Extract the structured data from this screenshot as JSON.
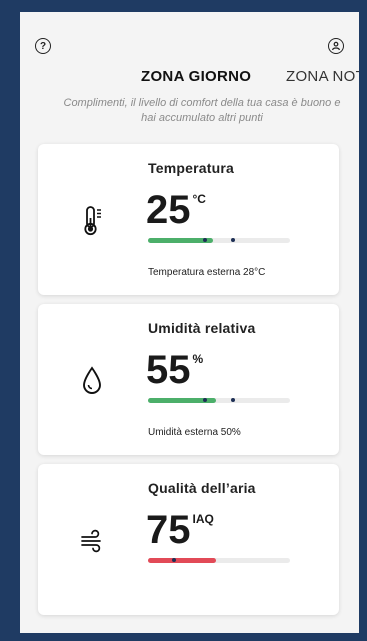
{
  "header": {
    "help_icon": "help-circle-icon",
    "user_icon": "user-circle-icon",
    "help_glyph": "?",
    "user_glyph": "☺"
  },
  "tabs": [
    {
      "label": "ZONA GIORNO",
      "active": true
    },
    {
      "label": "ZONA NOT",
      "active": false
    }
  ],
  "message": "Complimenti, il livello di comfort della tua casa è buono e hai accumulato altri punti",
  "cards": [
    {
      "title": "Temperatura",
      "value": "25",
      "unit": "°C",
      "icon": "thermometer-icon",
      "bar": {
        "fill": 0.46,
        "fill_color": "#4caf6a",
        "markers": [
          0.4,
          0.6
        ]
      },
      "note": "Temperatura esterna 28°C"
    },
    {
      "title": "Umidità relativa",
      "value": "55",
      "unit": "%",
      "icon": "droplet-icon",
      "bar": {
        "fill": 0.48,
        "fill_color": "#4caf6a",
        "markers": [
          0.4,
          0.6
        ]
      },
      "note": "Umidità esterna 50%"
    },
    {
      "title": "Qualità dell’aria",
      "value": "75",
      "unit": "IAQ",
      "icon": "wind-icon",
      "bar": {
        "fill": 0.48,
        "fill_color": "#e24a57",
        "markers": [
          0.18
        ]
      },
      "note": ""
    }
  ]
}
